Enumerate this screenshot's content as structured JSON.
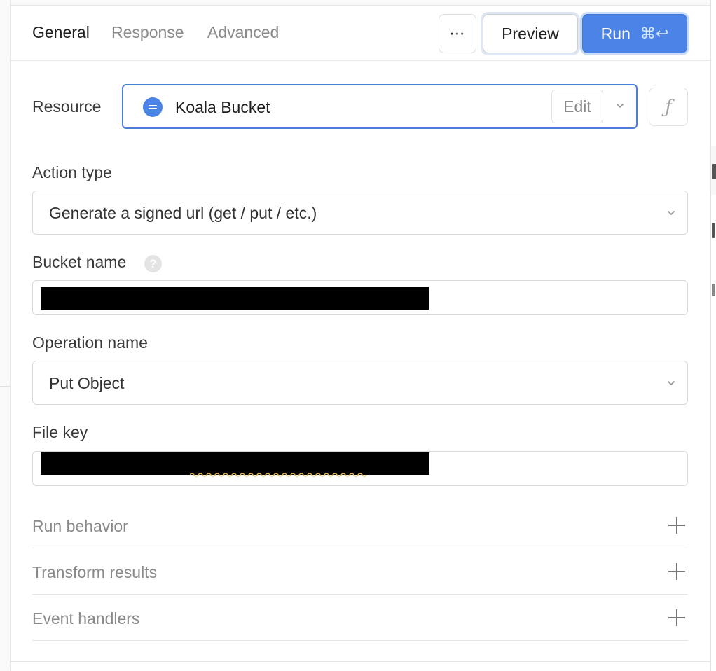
{
  "tabs": [
    {
      "label": "General",
      "active": true
    },
    {
      "label": "Response",
      "active": false
    },
    {
      "label": "Advanced",
      "active": false
    }
  ],
  "toolbar": {
    "more_label": "⋯",
    "preview_label": "Preview",
    "run_label": "Run",
    "run_shortcut": "⌘↩"
  },
  "resource": {
    "label": "Resource",
    "name": "Koala Bucket",
    "edit_label": "Edit",
    "icon": "database-icon",
    "fx_label": "ƒ"
  },
  "form": {
    "action_type": {
      "label": "Action type",
      "value": "Generate a signed url (get / put / etc.)"
    },
    "bucket_name": {
      "label": "Bucket name",
      "help": "?",
      "value": "[redacted]"
    },
    "operation_name": {
      "label": "Operation name",
      "value": "Put Object"
    },
    "file_key": {
      "label": "File key",
      "value": "[redacted]"
    }
  },
  "sections": [
    {
      "label": "Run behavior"
    },
    {
      "label": "Transform results"
    },
    {
      "label": "Event handlers"
    }
  ],
  "colors": {
    "accent": "#4b83e6",
    "resource_border": "#4b7fd8",
    "muted_text": "#8a8a8a"
  }
}
